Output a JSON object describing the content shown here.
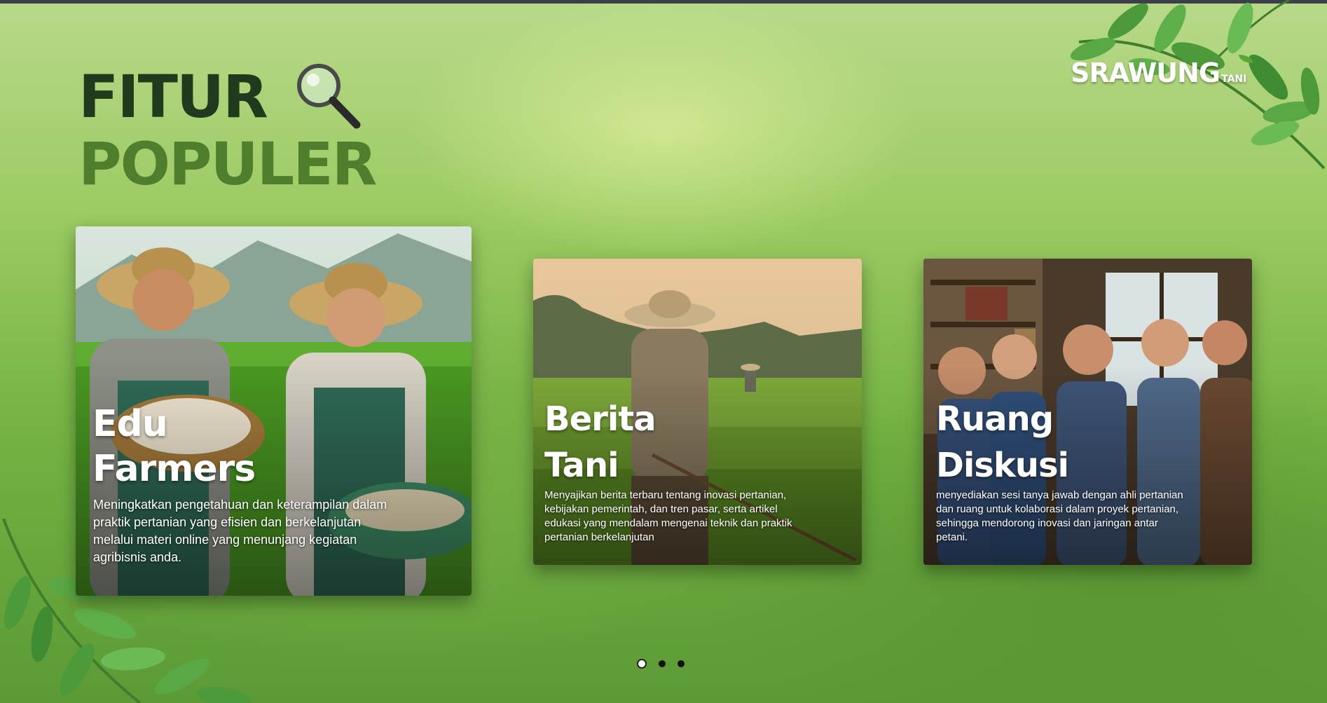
{
  "header": {
    "title_line1": "FITUR",
    "title_line2": "POPULER",
    "title_icon": "magnifier-icon"
  },
  "logo": {
    "main": "SRAWUNG",
    "sub": "TANI"
  },
  "cards": [
    {
      "title_line1": "Edu",
      "title_line2": "Farmers",
      "description": "Meningkatkan pengetahuan dan keterampilan dalam praktik pertanian yang efisien dan berkelanjutan melalui materi online yang menunjang kegiatan agribisnis anda."
    },
    {
      "title_line1": "Berita",
      "title_line2": "Tani",
      "description": "Menyajikan berita terbaru tentang inovasi pertanian, kebijakan pemerintah, dan tren pasar, serta artikel edukasi yang mendalam mengenai teknik dan praktik pertanian berkelanjutan"
    },
    {
      "title_line1": "Ruang",
      "title_line2": "Diskusi",
      "description": "menyediakan sesi tanya jawab dengan ahli pertanian dan ruang untuk kolaborasi dalam proyek pertanian, sehingga mendorong inovasi dan jaringan antar petani."
    }
  ],
  "carousel": {
    "active_index": 1,
    "total": 3
  },
  "colors": {
    "title_dark": "#1f3a1c",
    "title_green": "#4f7f2c",
    "leaf": "#4d9a3a"
  }
}
